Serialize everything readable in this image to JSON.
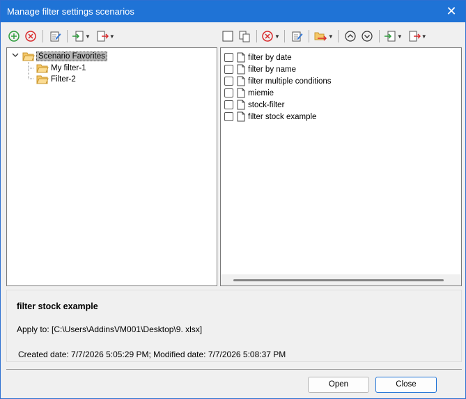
{
  "window": {
    "title": "Manage filter settings scenarios",
    "close_icon": "close-icon"
  },
  "left_toolbar": {
    "buttons": [
      "add-icon",
      "delete-icon",
      "edit-icon",
      "import-icon",
      "export-icon"
    ]
  },
  "right_toolbar": {
    "buttons": [
      "select-all-icon",
      "copy-icon",
      "delete-icon",
      "edit-icon",
      "move-to-folder-icon",
      "move-up-icon",
      "move-down-icon",
      "import-icon",
      "export-icon"
    ]
  },
  "tree": {
    "root": "Scenario Favorites",
    "children": [
      "My filter-1",
      "Filter-2"
    ]
  },
  "list": {
    "items": [
      "filter by date",
      "filter by name",
      "filter multiple conditions",
      "miemie",
      "stock-filter",
      "filter stock example"
    ]
  },
  "info": {
    "name": "filter stock example",
    "apply_to": "Apply to:  [C:\\Users\\AddinsVM001\\Desktop\\9. xlsx]",
    "dates": "Created date:  7/7/2026 5:05:29 PM;  Modified date:  7/7/2026 5:08:37 PM"
  },
  "buttons": {
    "open": "Open",
    "close": "Close"
  },
  "colors": {
    "title_bar": "#1f73d6",
    "add_green": "#2e9d3c",
    "delete_red": "#d9292b",
    "folder_yellow": "#f5c86a"
  }
}
